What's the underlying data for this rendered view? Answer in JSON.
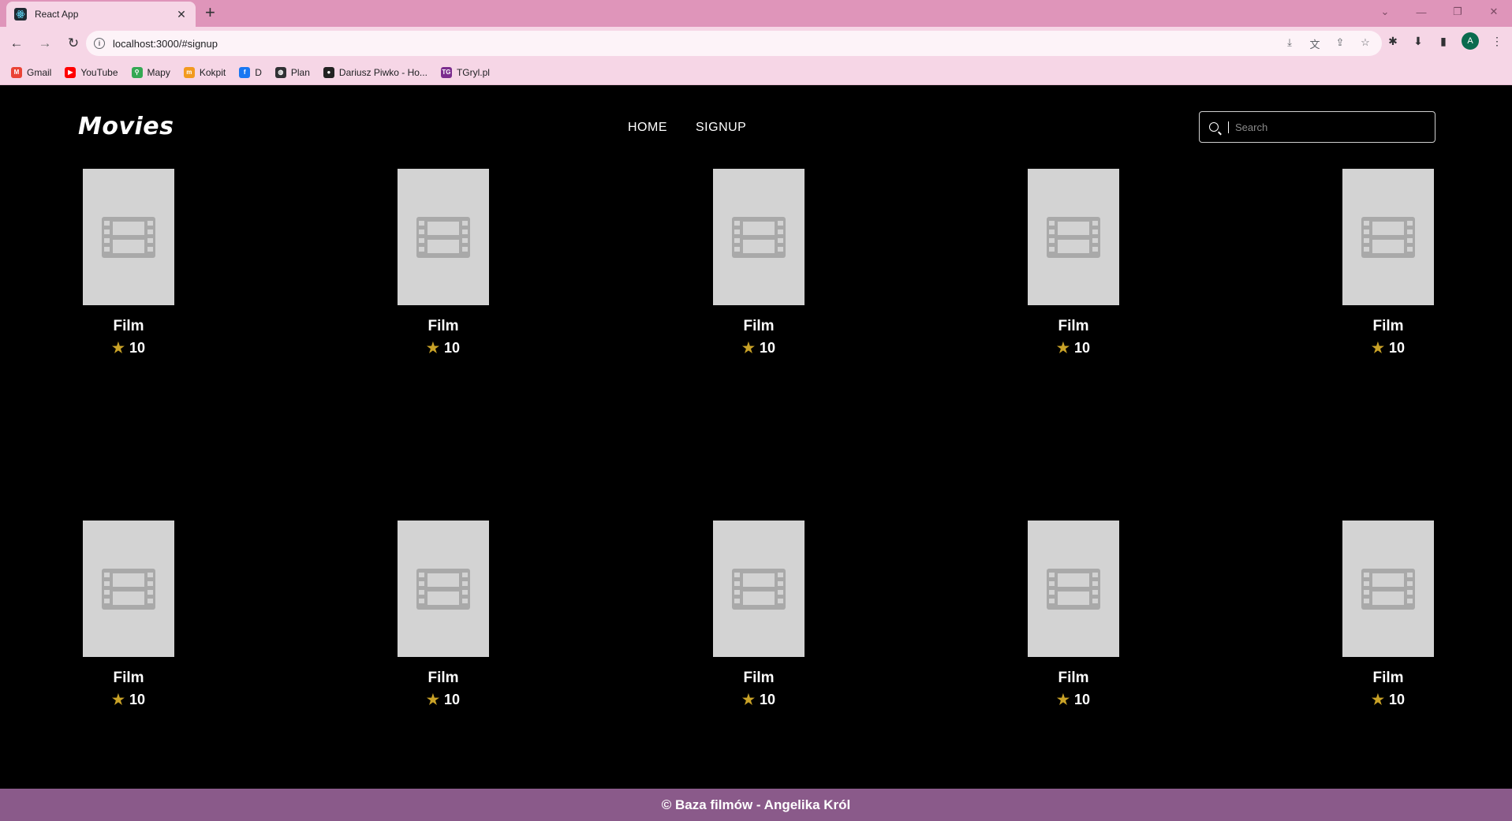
{
  "browser": {
    "tab_title": "React App",
    "url": "localhost:3000/#signup",
    "bookmarks": [
      {
        "label": "Gmail",
        "icon": "gmail-icon",
        "color": "#ea4335",
        "glyph": "M"
      },
      {
        "label": "YouTube",
        "icon": "youtube-icon",
        "color": "#ff0000",
        "glyph": "▶"
      },
      {
        "label": "Mapy",
        "icon": "maps-icon",
        "color": "#34a853",
        "glyph": "⚲"
      },
      {
        "label": "Kokpit",
        "icon": "kokpit-icon",
        "color": "#f29a1f",
        "glyph": "m"
      },
      {
        "label": "D",
        "icon": "facebook-icon",
        "color": "#1877f2",
        "glyph": "f"
      },
      {
        "label": "Plan",
        "icon": "globe-icon",
        "color": "#303134",
        "glyph": "◍"
      },
      {
        "label": "Dariusz Piwko - Ho...",
        "icon": "record-icon",
        "color": "#222222",
        "glyph": "●"
      },
      {
        "label": "TGryl.pl",
        "icon": "tgryl-icon",
        "color": "#7b2d8e",
        "glyph": "TG"
      }
    ],
    "profile_initial": "A"
  },
  "app": {
    "logo": "Movies",
    "nav": [
      {
        "label": "HOME"
      },
      {
        "label": "SIGNUP"
      }
    ],
    "search_placeholder": "Search",
    "movies": [
      {
        "title": "Film",
        "rating": "10"
      },
      {
        "title": "Film",
        "rating": "10"
      },
      {
        "title": "Film",
        "rating": "10"
      },
      {
        "title": "Film",
        "rating": "10"
      },
      {
        "title": "Film",
        "rating": "10"
      },
      {
        "title": "Film",
        "rating": "10"
      },
      {
        "title": "Film",
        "rating": "10"
      },
      {
        "title": "Film",
        "rating": "10"
      },
      {
        "title": "Film",
        "rating": "10"
      },
      {
        "title": "Film",
        "rating": "10"
      }
    ],
    "footer": "© Baza filmów - Angelika Król",
    "colors": {
      "tabbar": "#df95ba",
      "toolbar": "#f6d6e6",
      "page_bg": "#000000",
      "poster_placeholder": "#d3d3d3",
      "star": "#c9a227",
      "footer_bg": "#8a5a8a"
    }
  }
}
